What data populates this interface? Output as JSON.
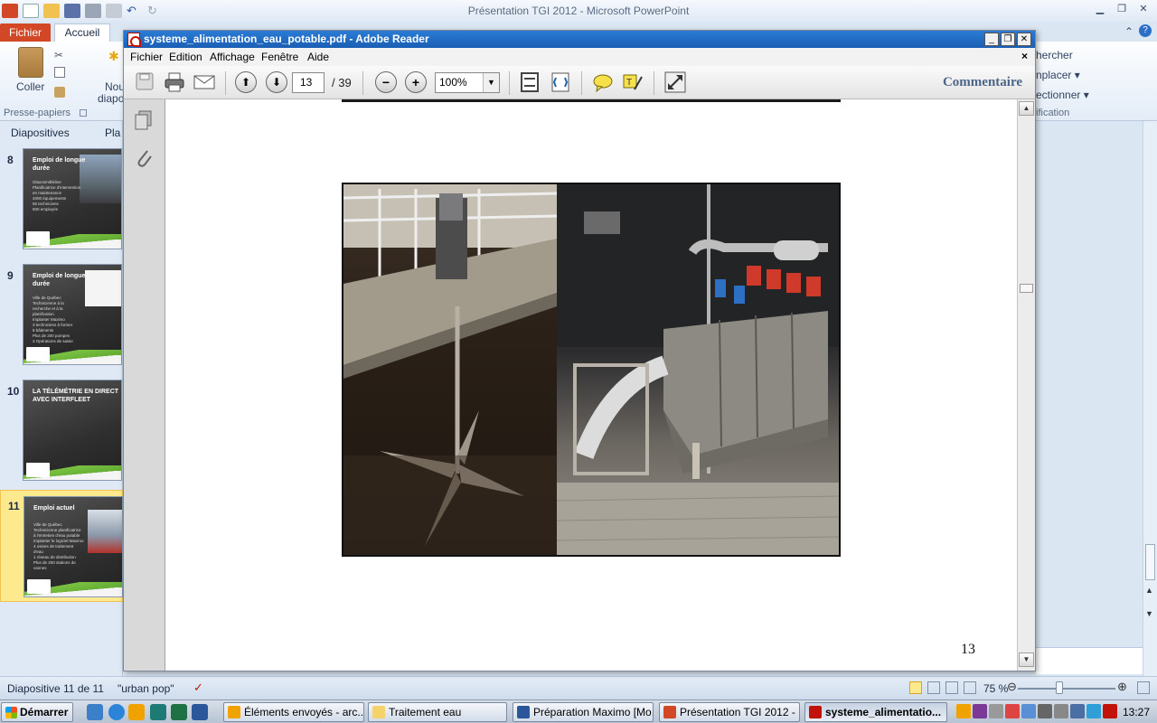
{
  "ppt": {
    "title": "Présentation TGI 2012  -  Microsoft PowerPoint",
    "tabs": {
      "fichier": "Fichier",
      "accueil": "Accueil"
    },
    "ribbon": {
      "paste": "Coller",
      "new_slide": "Nou",
      "new_slide2": "diapo",
      "clipboard_group": "Presse-papiers"
    },
    "right_panel": {
      "search": "hercher",
      "replace": "nplacer ▾",
      "select": "ectionner ▾",
      "group": "ification"
    },
    "left_panel": {
      "tab_slides": "Diapositives",
      "tab_outline": "Pla",
      "slides": [
        {
          "num": "8",
          "title": "Emploi de longue durée",
          "body": "Glaxosmithkline\nPlanificatrice d'intervention en maintenance\n4000 équipements\n55 techniciens\n600 employés"
        },
        {
          "num": "9",
          "title": "Emploi de longue durée",
          "body": "Ville de Québec\nTechnicienne à la recherche et à la planification\nImplanter Maximo\n3 techniciens à former\n8 bâtiments\nPlus de 200 pompes\n3 Opérations de saisie"
        },
        {
          "num": "10",
          "title": "LA TÉLÉMÉTRIE EN DIRECT AVEC INTERFLEET",
          "body": ""
        },
        {
          "num": "11",
          "title": "Emploi actuel",
          "body": "Ville de Québec\nTechnicienne planificatrice à l'entretien d'eau potable\nImplanter le logiciel Maximo\n4 usines de traitement d'eau\n1 réseau de distribution\nPlus de 200 stations de vannes"
        }
      ]
    },
    "status": {
      "slide_count": "Diapositive 11 de 11",
      "theme": "\"urban pop\"",
      "zoom": "75 %"
    }
  },
  "reader": {
    "title": "systeme_alimentation_eau_potable.pdf - Adobe Reader",
    "menu": [
      "Fichier",
      "Edition",
      "Affichage",
      "Fenêtre",
      "Aide"
    ],
    "close_doc": "×",
    "toolbar": {
      "current_page": "13",
      "total_pages": "/   39",
      "zoom": "100%",
      "comment_label": "Commentaire"
    },
    "page_number_label": "13"
  },
  "taskbar": {
    "start": "Démarrer",
    "buttons": [
      {
        "label": "Éléments envoyés - arc...",
        "icon_color": "#f0a300"
      },
      {
        "label": "Traitement eau",
        "icon_color": "#f6d26b"
      },
      {
        "label": "Préparation Maximo [Mo...",
        "icon_color": "#2b579a"
      },
      {
        "label": "Présentation TGI 2012 - ...",
        "icon_color": "#d24726"
      },
      {
        "label": "systeme_alimentatio...",
        "icon_color": "#c1130a"
      }
    ],
    "clock": "13:27"
  },
  "colors": {
    "ppt_accent": "#d24726",
    "reader_title": "#1a5fb4",
    "highlight": "#fde98e"
  }
}
